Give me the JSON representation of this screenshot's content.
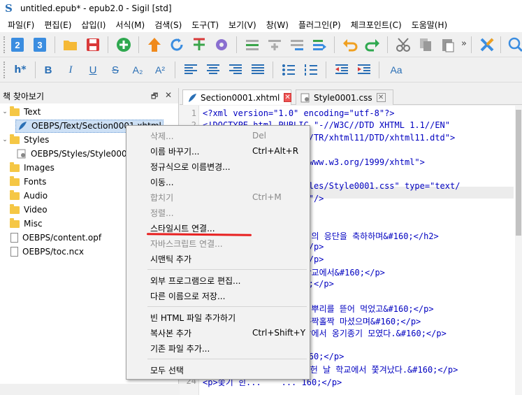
{
  "window": {
    "title": "untitled.epub* - epub2.0 - Sigil [std]",
    "app_icon": "S"
  },
  "menu": [
    "파일(F)",
    "편집(E)",
    "삽입(I)",
    "서식(M)",
    "검색(S)",
    "도구(T)",
    "보기(V)",
    "창(W)",
    "플러그인(P)",
    "체크포인트(C)",
    "도움말(H)"
  ],
  "toolbar": {
    "more": "»",
    "icons": [
      "book-view",
      "code-view",
      "open",
      "save",
      "add",
      "up",
      "refresh",
      "add-green",
      "settings",
      "insert-id",
      "insert-index",
      "insert-toc",
      "generate-toc",
      "undo",
      "redo",
      "cut",
      "copy",
      "paste",
      "validate",
      "search"
    ]
  },
  "format_toolbar": {
    "heading": "h*",
    "bold": "B",
    "italic": "I",
    "underline": "U",
    "strike": "S",
    "subscript": "A₂",
    "superscript": "A²",
    "language": "Aa"
  },
  "panel": {
    "title": "책 찾아보기",
    "undock": "🗗",
    "close": "✕",
    "tree": [
      {
        "label": "Text",
        "type": "folder",
        "indent": 0,
        "expanded": true
      },
      {
        "label": "OEBPS/Text/Section0001.xhtml",
        "type": "xhtml",
        "indent": 1,
        "selected": true
      },
      {
        "label": "Styles",
        "type": "folder",
        "indent": 0,
        "expanded": true
      },
      {
        "label": "OEBPS/Styles/Style0001.css",
        "type": "css",
        "indent": 1
      },
      {
        "label": "Images",
        "type": "folder",
        "indent": 0
      },
      {
        "label": "Fonts",
        "type": "folder",
        "indent": 0
      },
      {
        "label": "Audio",
        "type": "folder",
        "indent": 0
      },
      {
        "label": "Video",
        "type": "folder",
        "indent": 0
      },
      {
        "label": "Misc",
        "type": "folder",
        "indent": 0
      },
      {
        "label": "OEBPS/content.opf",
        "type": "file",
        "indent": 0
      },
      {
        "label": "OEBPS/toc.ncx",
        "type": "file",
        "indent": 0
      }
    ]
  },
  "tabs": [
    {
      "label": "Section0001.xhtml",
      "active": true
    },
    {
      "label": "Style0001.css",
      "active": false
    }
  ],
  "editor": {
    "lines": [
      {
        "n": "1",
        "code": "<?xml version=\"1.0\" encoding=\"utf-8\"?>"
      },
      {
        "n": "2",
        "code": "<!DOCTYPE html PUBLIC \"-//W3C//DTD XHTML 1.1//EN\""
      },
      {
        "n": "",
        "code": "                    g/TR/xhtml11/DTD/xhtml11.dtd\">"
      },
      {
        "n": "",
        "code": ""
      },
      {
        "n": "",
        "code": "                    /www.w3.org/1999/xhtml\">"
      },
      {
        "n": "",
        "code": ""
      },
      {
        "n": "",
        "code": "                    yles/Style0001.css\" type=\"text/"
      },
      {
        "n": "",
        "code": "                    t\"/>"
      },
      {
        "n": "",
        "code": ""
      },
      {
        "n": "",
        "code": ""
      },
      {
        "n": "",
        "code": "                    성의 응단을 축하하며&#160;</h2>"
      },
      {
        "n": "",
        "code": "                    </p>"
      },
      {
        "n": "",
        "code": "                    </p>"
      },
      {
        "n": "",
        "code": "                    학교에서&#160;</p>"
      },
      {
        "n": "",
        "code": "                    0;</p>"
      },
      {
        "n": "",
        "code": ""
      },
      {
        "n": "",
        "code": "                    칡뿌리를 뜯어 먹었고&#160;</p>"
      },
      {
        "n": "",
        "code": "                    홀짝홀짝 마셨으며&#160;</p>"
      },
      {
        "n": "",
        "code": "                    앞에서 옹기종기 모였다.&#160;</p>"
      },
      {
        "n": "",
        "code": ""
      },
      {
        "n": "",
        "code": "                    160;</p>"
      },
      {
        "n": "23",
        "code": "<p>월사금을 내지 못해 허구헌 날 학교에서 쫓겨났다.&#160;</p>"
      },
      {
        "n": "24",
        "code": "<p>쫓기 힌...    ... 160;</p>"
      }
    ]
  },
  "context_menu": {
    "items": [
      {
        "label": "삭제...",
        "shortcut": "Del",
        "disabled": true
      },
      {
        "label": "이름 바꾸기...",
        "shortcut": "Ctrl+Alt+R",
        "disabled": false
      },
      {
        "label": "정규식으로 이름변경...",
        "shortcut": "",
        "disabled": false
      },
      {
        "label": "이동...",
        "shortcut": "",
        "disabled": false
      },
      {
        "label": "합치기",
        "shortcut": "Ctrl+M",
        "disabled": true
      },
      {
        "label": "정렬...",
        "shortcut": "",
        "disabled": true
      },
      {
        "label": "스타일시트 연결...",
        "shortcut": "",
        "disabled": false
      },
      {
        "label": "자바스크립트 연결...",
        "shortcut": "",
        "disabled": true
      },
      {
        "label": "시맨틱 추가",
        "shortcut": "",
        "disabled": false
      },
      {
        "label": "외부 프로그램으로 편집...",
        "shortcut": "",
        "disabled": false
      },
      {
        "label": "다른 이름으로 저장...",
        "shortcut": "",
        "disabled": false
      },
      {
        "label": "빈 HTML 파일 추가하기",
        "shortcut": "",
        "disabled": false
      },
      {
        "label": "복사본 추가",
        "shortcut": "Ctrl+Shift+Y",
        "disabled": false
      },
      {
        "label": "기존 파일 추가...",
        "shortcut": "",
        "disabled": false
      },
      {
        "label": "모두 선택",
        "shortcut": "",
        "disabled": false
      }
    ]
  }
}
